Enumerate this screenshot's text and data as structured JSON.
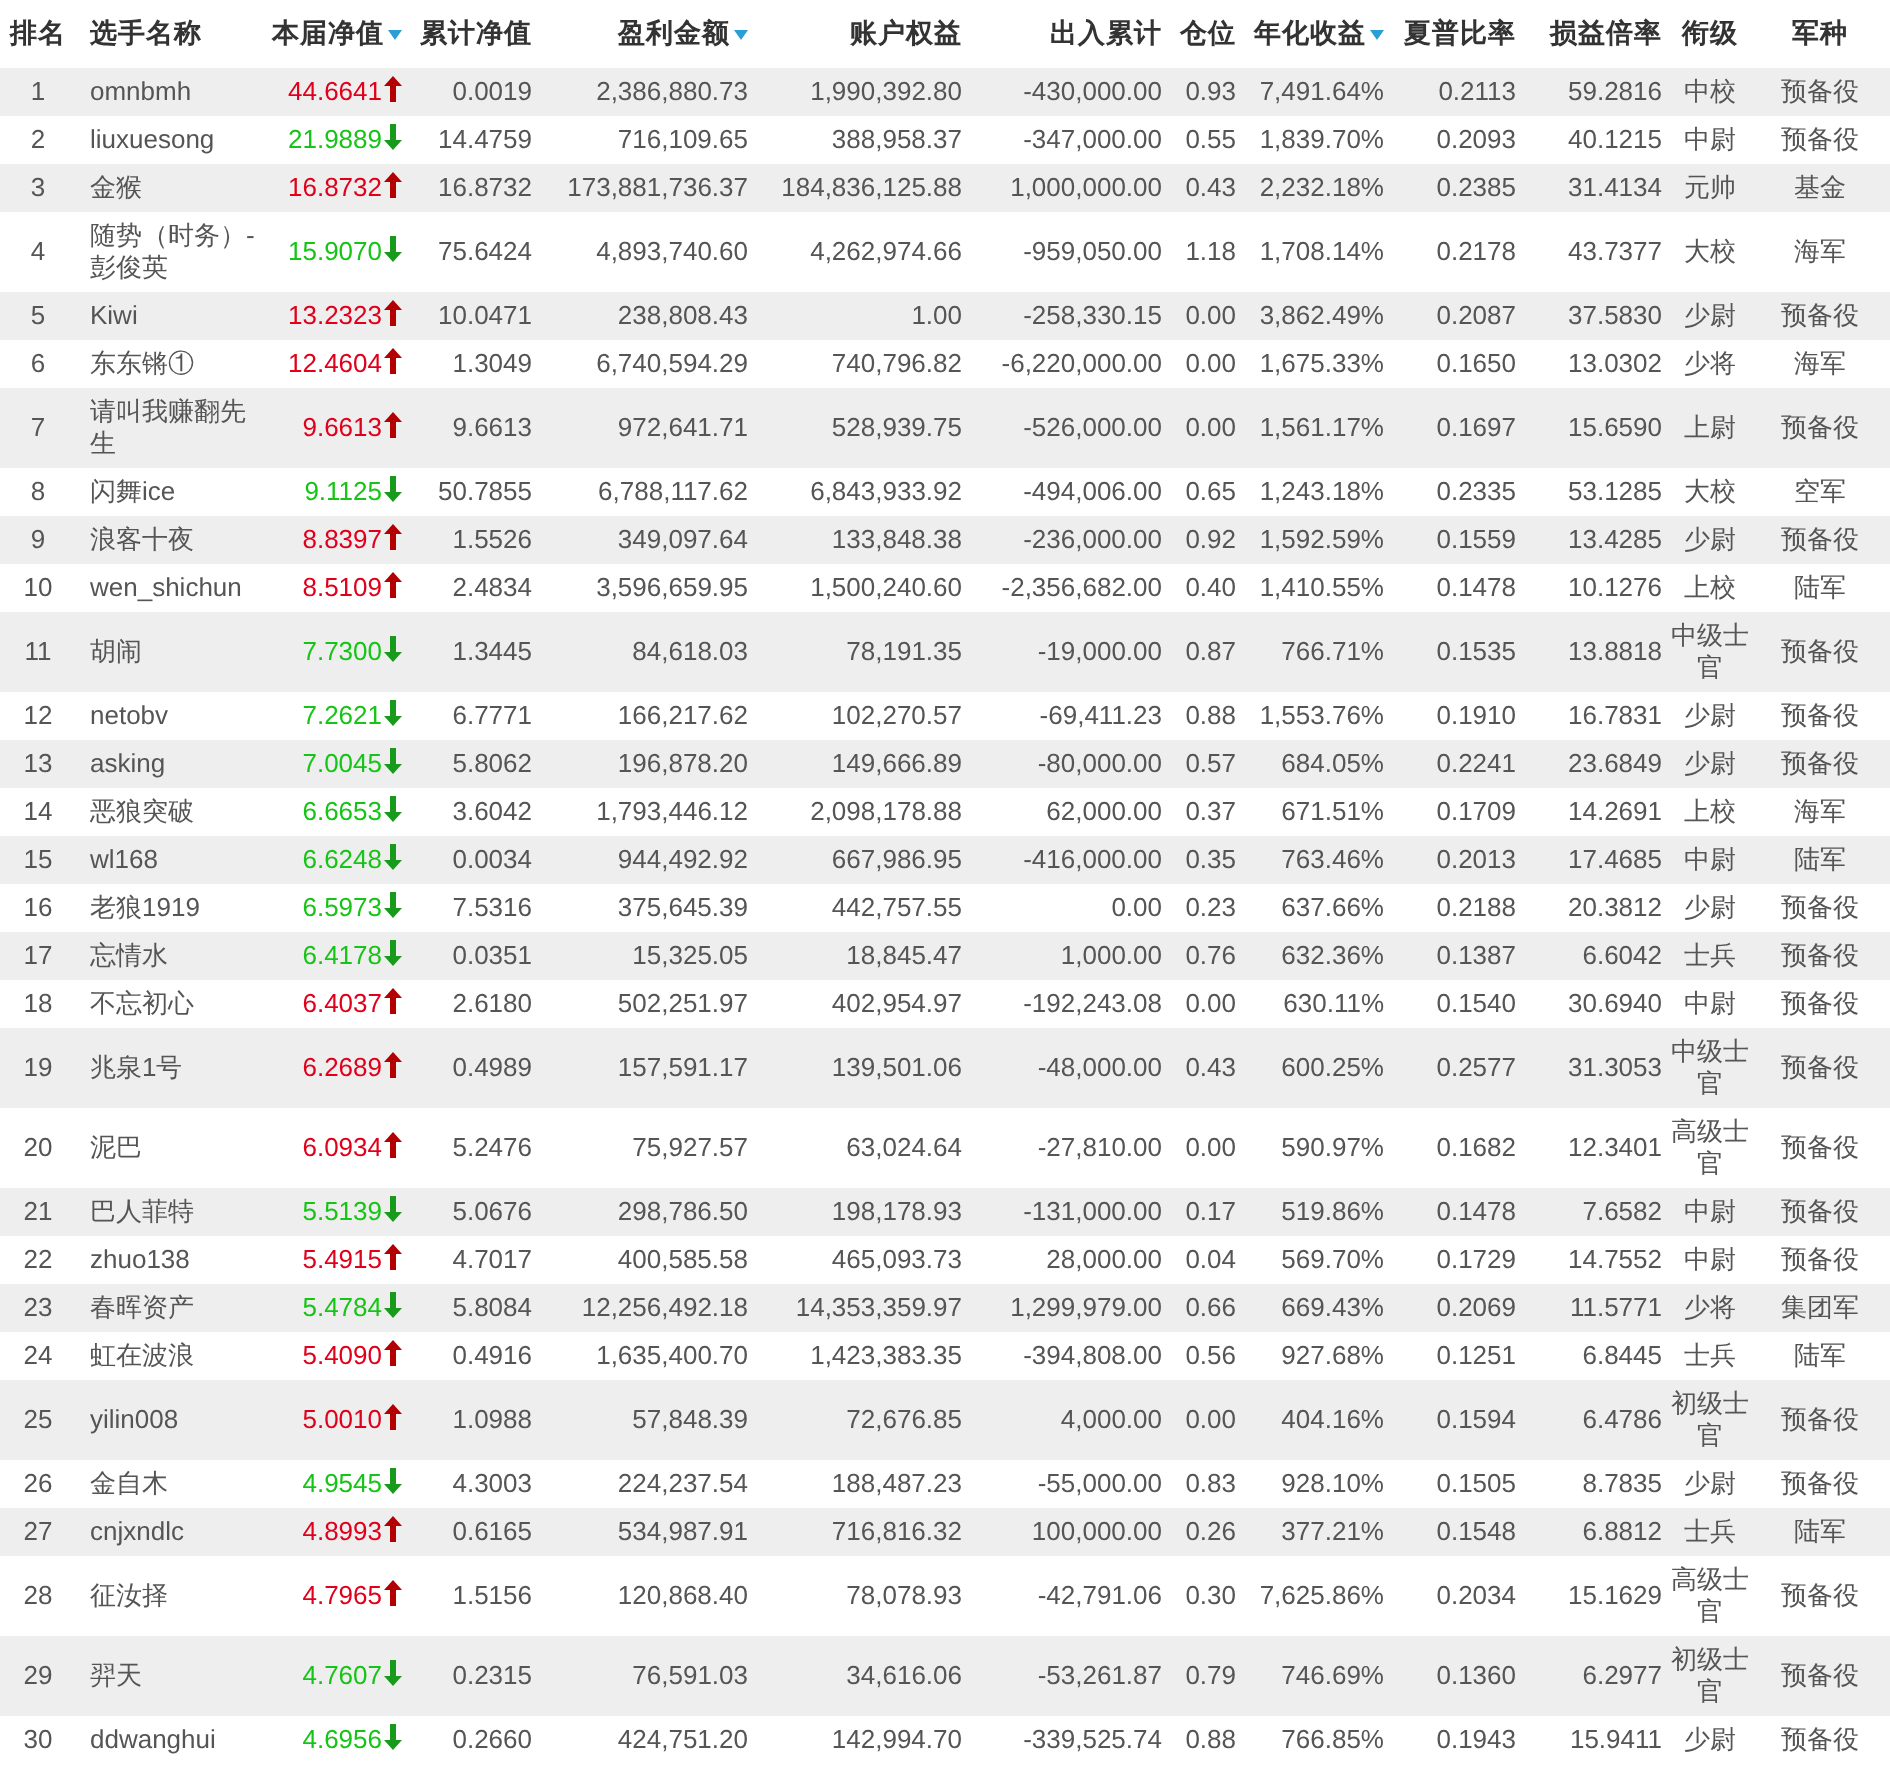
{
  "table": {
    "columns": [
      {
        "label": "排名",
        "sorted": false
      },
      {
        "label": "选手名称",
        "sorted": false
      },
      {
        "label": "本届净值",
        "sorted": true
      },
      {
        "label": "累计净值",
        "sorted": false
      },
      {
        "label": "盈利金额",
        "sorted": true
      },
      {
        "label": "账户权益",
        "sorted": false
      },
      {
        "label": "出入累计",
        "sorted": false
      },
      {
        "label": "仓位",
        "sorted": false
      },
      {
        "label": "年化收益",
        "sorted": true
      },
      {
        "label": "夏普比率",
        "sorted": false
      },
      {
        "label": "损益倍率",
        "sorted": false
      },
      {
        "label": "衔级",
        "sorted": false
      },
      {
        "label": "军种",
        "sorted": false
      }
    ],
    "rows": [
      {
        "rising": true,
        "cells": [
          "1",
          "omnbmh",
          "44.6641",
          "0.0019",
          "2,386,880.73",
          "1,990,392.80",
          "-430,000.00",
          "0.93",
          "7,491.64%",
          "0.2113",
          "59.2816",
          "中校",
          "预备役"
        ]
      },
      {
        "rising": false,
        "cells": [
          "2",
          "liuxuesong",
          "21.9889",
          "14.4759",
          "716,109.65",
          "388,958.37",
          "-347,000.00",
          "0.55",
          "1,839.70%",
          "0.2093",
          "40.1215",
          "中尉",
          "预备役"
        ]
      },
      {
        "rising": true,
        "cells": [
          "3",
          "金猴",
          "16.8732",
          "16.8732",
          "173,881,736.37",
          "184,836,125.88",
          "1,000,000.00",
          "0.43",
          "2,232.18%",
          "0.2385",
          "31.4134",
          "元帅",
          "基金"
        ]
      },
      {
        "rising": false,
        "cells": [
          "4",
          "随势（时务）-彭俊英",
          "15.9070",
          "75.6424",
          "4,893,740.60",
          "4,262,974.66",
          "-959,050.00",
          "1.18",
          "1,708.14%",
          "0.2178",
          "43.7377",
          "大校",
          "海军"
        ]
      },
      {
        "rising": true,
        "cells": [
          "5",
          "Kiwi",
          "13.2323",
          "10.0471",
          "238,808.43",
          "1.00",
          "-258,330.15",
          "0.00",
          "3,862.49%",
          "0.2087",
          "37.5830",
          "少尉",
          "预备役"
        ]
      },
      {
        "rising": true,
        "cells": [
          "6",
          "东东锵①",
          "12.4604",
          "1.3049",
          "6,740,594.29",
          "740,796.82",
          "-6,220,000.00",
          "0.00",
          "1,675.33%",
          "0.1650",
          "13.0302",
          "少将",
          "海军"
        ]
      },
      {
        "rising": true,
        "cells": [
          "7",
          "请叫我赚翻先生",
          "9.6613",
          "9.6613",
          "972,641.71",
          "528,939.75",
          "-526,000.00",
          "0.00",
          "1,561.17%",
          "0.1697",
          "15.6590",
          "上尉",
          "预备役"
        ]
      },
      {
        "rising": false,
        "cells": [
          "8",
          "闪舞ice",
          "9.1125",
          "50.7855",
          "6,788,117.62",
          "6,843,933.92",
          "-494,006.00",
          "0.65",
          "1,243.18%",
          "0.2335",
          "53.1285",
          "大校",
          "空军"
        ]
      },
      {
        "rising": true,
        "cells": [
          "9",
          "浪客十夜",
          "8.8397",
          "1.5526",
          "349,097.64",
          "133,848.38",
          "-236,000.00",
          "0.92",
          "1,592.59%",
          "0.1559",
          "13.4285",
          "少尉",
          "预备役"
        ]
      },
      {
        "rising": true,
        "cells": [
          "10",
          "wen_shichun",
          "8.5109",
          "2.4834",
          "3,596,659.95",
          "1,500,240.60",
          "-2,356,682.00",
          "0.40",
          "1,410.55%",
          "0.1478",
          "10.1276",
          "上校",
          "陆军"
        ]
      },
      {
        "rising": false,
        "cells": [
          "11",
          "胡闹",
          "7.7300",
          "1.3445",
          "84,618.03",
          "78,191.35",
          "-19,000.00",
          "0.87",
          "766.71%",
          "0.1535",
          "13.8818",
          "中级士官",
          "预备役"
        ]
      },
      {
        "rising": false,
        "cells": [
          "12",
          "netobv",
          "7.2621",
          "6.7771",
          "166,217.62",
          "102,270.57",
          "-69,411.23",
          "0.88",
          "1,553.76%",
          "0.1910",
          "16.7831",
          "少尉",
          "预备役"
        ]
      },
      {
        "rising": false,
        "cells": [
          "13",
          "asking",
          "7.0045",
          "5.8062",
          "196,878.20",
          "149,666.89",
          "-80,000.00",
          "0.57",
          "684.05%",
          "0.2241",
          "23.6849",
          "少尉",
          "预备役"
        ]
      },
      {
        "rising": false,
        "cells": [
          "14",
          "恶狼突破",
          "6.6653",
          "3.6042",
          "1,793,446.12",
          "2,098,178.88",
          "62,000.00",
          "0.37",
          "671.51%",
          "0.1709",
          "14.2691",
          "上校",
          "海军"
        ]
      },
      {
        "rising": false,
        "cells": [
          "15",
          "wl168",
          "6.6248",
          "0.0034",
          "944,492.92",
          "667,986.95",
          "-416,000.00",
          "0.35",
          "763.46%",
          "0.2013",
          "17.4685",
          "中尉",
          "陆军"
        ]
      },
      {
        "rising": false,
        "cells": [
          "16",
          "老狼1919",
          "6.5973",
          "7.5316",
          "375,645.39",
          "442,757.55",
          "0.00",
          "0.23",
          "637.66%",
          "0.2188",
          "20.3812",
          "少尉",
          "预备役"
        ]
      },
      {
        "rising": false,
        "cells": [
          "17",
          "忘情水",
          "6.4178",
          "0.0351",
          "15,325.05",
          "18,845.47",
          "1,000.00",
          "0.76",
          "632.36%",
          "0.1387",
          "6.6042",
          "士兵",
          "预备役"
        ]
      },
      {
        "rising": true,
        "cells": [
          "18",
          "不忘初心",
          "6.4037",
          "2.6180",
          "502,251.97",
          "402,954.97",
          "-192,243.08",
          "0.00",
          "630.11%",
          "0.1540",
          "30.6940",
          "中尉",
          "预备役"
        ]
      },
      {
        "rising": true,
        "cells": [
          "19",
          "兆泉1号",
          "6.2689",
          "0.4989",
          "157,591.17",
          "139,501.06",
          "-48,000.00",
          "0.43",
          "600.25%",
          "0.2577",
          "31.3053",
          "中级士官",
          "预备役"
        ]
      },
      {
        "rising": true,
        "cells": [
          "20",
          "泥巴",
          "6.0934",
          "5.2476",
          "75,927.57",
          "63,024.64",
          "-27,810.00",
          "0.00",
          "590.97%",
          "0.1682",
          "12.3401",
          "高级士官",
          "预备役"
        ]
      },
      {
        "rising": false,
        "cells": [
          "21",
          "巴人菲特",
          "5.5139",
          "5.0676",
          "298,786.50",
          "198,178.93",
          "-131,000.00",
          "0.17",
          "519.86%",
          "0.1478",
          "7.6582",
          "中尉",
          "预备役"
        ]
      },
      {
        "rising": true,
        "cells": [
          "22",
          "zhuo138",
          "5.4915",
          "4.7017",
          "400,585.58",
          "465,093.73",
          "28,000.00",
          "0.04",
          "569.70%",
          "0.1729",
          "14.7552",
          "中尉",
          "预备役"
        ]
      },
      {
        "rising": false,
        "cells": [
          "23",
          "春晖资产",
          "5.4784",
          "5.8084",
          "12,256,492.18",
          "14,353,359.97",
          "1,299,979.00",
          "0.66",
          "669.43%",
          "0.2069",
          "11.5771",
          "少将",
          "集团军"
        ]
      },
      {
        "rising": true,
        "cells": [
          "24",
          "虹在波浪",
          "5.4090",
          "0.4916",
          "1,635,400.70",
          "1,423,383.35",
          "-394,808.00",
          "0.56",
          "927.68%",
          "0.1251",
          "6.8445",
          "士兵",
          "陆军"
        ]
      },
      {
        "rising": true,
        "cells": [
          "25",
          "yilin008",
          "5.0010",
          "1.0988",
          "57,848.39",
          "72,676.85",
          "4,000.00",
          "0.00",
          "404.16%",
          "0.1594",
          "6.4786",
          "初级士官",
          "预备役"
        ]
      },
      {
        "rising": false,
        "cells": [
          "26",
          "金自木",
          "4.9545",
          "4.3003",
          "224,237.54",
          "188,487.23",
          "-55,000.00",
          "0.83",
          "928.10%",
          "0.1505",
          "8.7835",
          "少尉",
          "预备役"
        ]
      },
      {
        "rising": true,
        "cells": [
          "27",
          "cnjxndlc",
          "4.8993",
          "0.6165",
          "534,987.91",
          "716,816.32",
          "100,000.00",
          "0.26",
          "377.21%",
          "0.1548",
          "6.8812",
          "士兵",
          "陆军"
        ]
      },
      {
        "rising": true,
        "cells": [
          "28",
          "征汝择",
          "4.7965",
          "1.5156",
          "120,868.40",
          "78,078.93",
          "-42,791.06",
          "0.30",
          "7,625.86%",
          "0.2034",
          "15.1629",
          "高级士官",
          "预备役"
        ]
      },
      {
        "rising": false,
        "cells": [
          "29",
          "羿天",
          "4.7607",
          "0.2315",
          "76,591.03",
          "34,616.06",
          "-53,261.87",
          "0.79",
          "746.69%",
          "0.1360",
          "6.2977",
          "初级士官",
          "预备役"
        ]
      },
      {
        "rising": false,
        "cells": [
          "30",
          "ddwanghui",
          "4.6956",
          "0.2660",
          "424,751.20",
          "142,994.70",
          "-339,525.74",
          "0.88",
          "766.85%",
          "0.1943",
          "15.9411",
          "少尉",
          "预备役"
        ]
      }
    ]
  }
}
